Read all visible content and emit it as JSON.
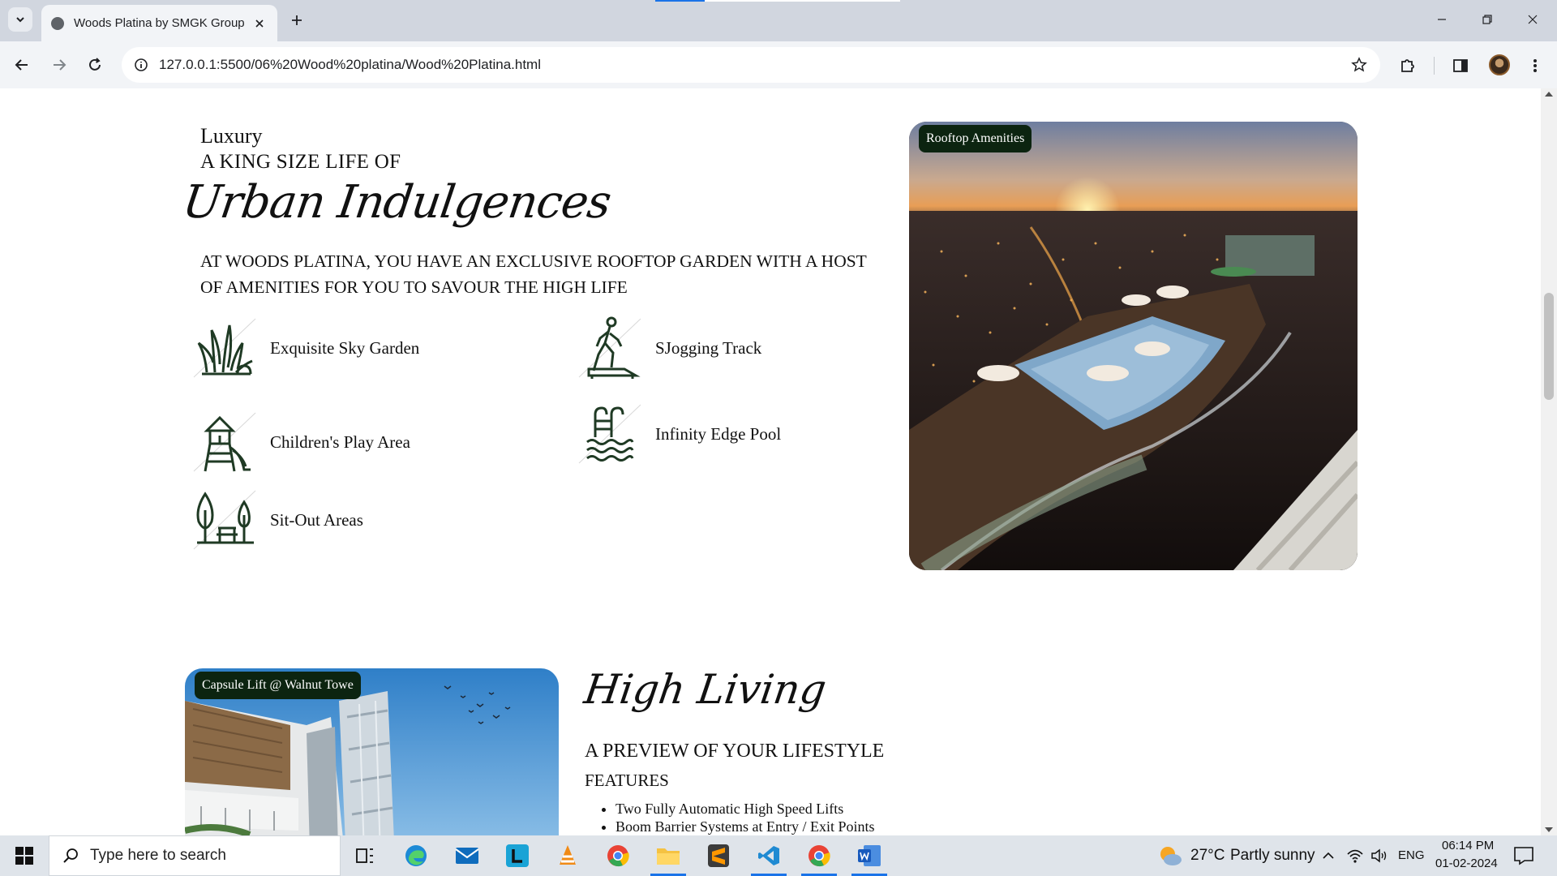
{
  "browser": {
    "tab_title": "Woods Platina by SMGK Group",
    "url": "127.0.0.1:5500/06%20Wood%20platina/Wood%20Platina.html"
  },
  "section1": {
    "kicker": "Luxury",
    "subhead": "A KING SIZE LIFE OF",
    "script_title": "Urban Indulgences",
    "lead": "AT WOODS PLATINA, YOU HAVE AN EXCLUSIVE ROOFTOP GARDEN WITH A HOST OF AMENITIES FOR YOU TO SAVOUR THE HIGH LIFE",
    "amenities": [
      {
        "label": "Exquisite Sky Garden",
        "icon": "sky-garden-icon"
      },
      {
        "label": "SJogging Track",
        "icon": "jogging-track-icon"
      },
      {
        "label": "Children's Play Area",
        "icon": "play-area-icon"
      },
      {
        "label": "Infinity Edge Pool",
        "icon": "pool-icon"
      },
      {
        "label": "Sit-Out Areas",
        "icon": "sit-out-icon"
      }
    ],
    "photo_badge": "Rooftop Amenities"
  },
  "section2": {
    "photo_badge": "Capsule Lift @ Walnut Towe",
    "script_title": "High Living",
    "subhead": "A PREVIEW OF YOUR LIFESTYLE",
    "features_heading": "FEATURES",
    "features": [
      "Two Fully Automatic High Speed Lifts",
      "Boom Barrier Systems at Entry / Exit Points"
    ]
  },
  "taskbar": {
    "search_placeholder": "Type here to search",
    "weather_temp": "27°C",
    "weather_text": "Partly sunny",
    "language": "ENG",
    "time": "06:14 PM",
    "date": "01-02-2024"
  },
  "colors": {
    "badge_bg": "#0c2410",
    "icon_green": "#1f3a24",
    "accent_blue": "#1a73e8"
  }
}
